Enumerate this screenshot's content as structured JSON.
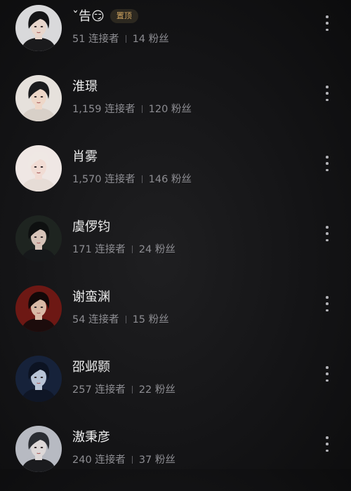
{
  "connections": [
    {
      "name": "ˇ告😏",
      "badge": "置顶",
      "connectors": "51 连接者",
      "fans": "14 粉丝",
      "palette": {
        "bg": "#d9d9db",
        "hair": "#141416",
        "skin": "#e8d6cc",
        "cloth": "#1a1a1c"
      }
    },
    {
      "name": "淮璟",
      "connectors": "1,159 连接者",
      "fans": "120 粉丝",
      "palette": {
        "bg": "#e6e1dc",
        "hair": "#1b1b1d",
        "skin": "#eed7c8",
        "cloth": "#d8d0c8"
      }
    },
    {
      "name": "肖雾",
      "connectors": "1,570 连接者",
      "fans": "146 粉丝",
      "palette": {
        "bg": "#efe7e4",
        "hair": "#efe8e4",
        "skin": "#f1dcd4",
        "cloth": "#e6dcd6"
      }
    },
    {
      "name": "虞㑩钧",
      "connectors": "171 连接者",
      "fans": "24 粉丝",
      "palette": {
        "bg": "#1e2420",
        "hair": "#0e1010",
        "skin": "#d6c3b8",
        "cloth": "#16181a"
      }
    },
    {
      "name": "谢蛮渊",
      "connectors": "54 连接者",
      "fans": "15 粉丝",
      "palette": {
        "bg": "#6d1814",
        "hair": "#120808",
        "skin": "#d9b9a6",
        "cloth": "#1c0c0c"
      }
    },
    {
      "name": "邵邺颢",
      "connectors": "257 连接者",
      "fans": "22 粉丝",
      "palette": {
        "bg": "#16223a",
        "hair": "#0c1322",
        "skin": "#b8c4d6",
        "cloth": "#0f1626"
      }
    },
    {
      "name": "滶秉彦",
      "connectors": "240 连接者",
      "fans": "37 粉丝",
      "palette": {
        "bg": "#b7bac2",
        "hair": "#2a2d33",
        "skin": "#ddd8d8",
        "cloth": "#1a1b1e"
      }
    }
  ]
}
